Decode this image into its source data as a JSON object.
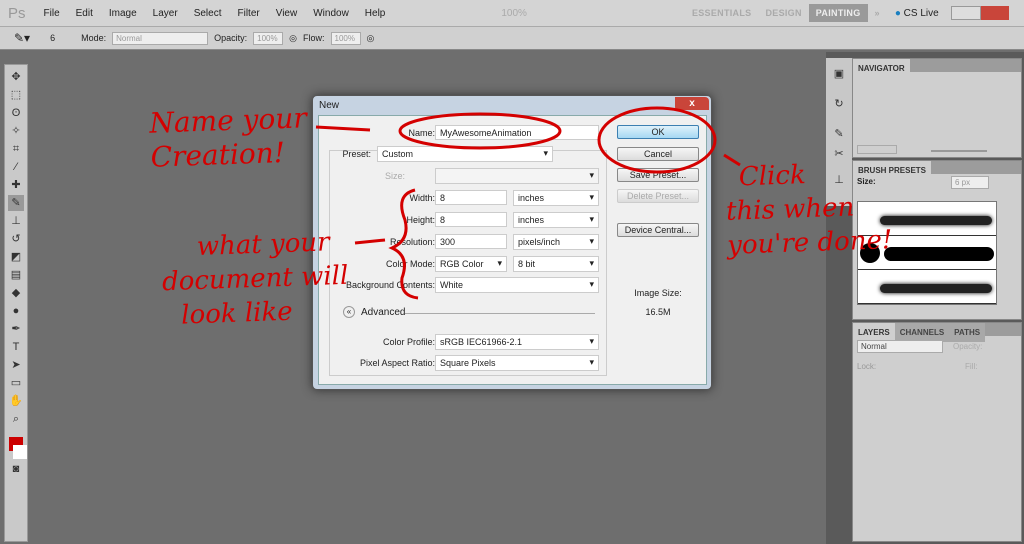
{
  "menubar": {
    "logo": "Ps",
    "items": [
      "File",
      "Edit",
      "Image",
      "Layer",
      "Select",
      "Filter",
      "View",
      "Window",
      "Help"
    ],
    "zoom": "100%",
    "workspaces": [
      "ESSENTIALS",
      "DESIGN",
      "PAINTING"
    ],
    "active_workspace": "PAINTING",
    "more": "»",
    "cslive": "CS Live"
  },
  "options": {
    "brush_size": "6",
    "mode_label": "Mode:",
    "mode": "Normal",
    "opacity_label": "Opacity:",
    "opacity": "100%",
    "flow_label": "Flow:",
    "flow": "100%"
  },
  "panels": {
    "navigator": "NAVIGATOR",
    "brush_presets": "BRUSH PRESETS",
    "size_label": "Size:",
    "size_value": "6 px",
    "layers_tabs": [
      "LAYERS",
      "CHANNELS",
      "PATHS"
    ],
    "blend": "Normal",
    "opacity_label": "Opacity:",
    "lock_label": "Lock:",
    "fill_label": "Fill:"
  },
  "dialog": {
    "title": "New",
    "close": "x",
    "name_label": "Name:",
    "name": "MyAwesomeAnimation",
    "preset_label": "Preset:",
    "preset": "Custom",
    "size_label": "Size:",
    "width_label": "Width:",
    "width": "8",
    "width_unit": "inches",
    "height_label": "Height:",
    "height": "8",
    "height_unit": "inches",
    "res_label": "Resolution:",
    "res": "300",
    "res_unit": "pixels/inch",
    "mode_label": "Color Mode:",
    "mode": "RGB Color",
    "depth": "8 bit",
    "bg_label": "Background Contents:",
    "bg": "White",
    "advanced": "Advanced",
    "profile_label": "Color Profile:",
    "profile": "sRGB IEC61966-2.1",
    "par_label": "Pixel Aspect Ratio:",
    "par": "Square Pixels",
    "ok": "OK",
    "cancel": "Cancel",
    "save_preset": "Save Preset...",
    "delete_preset": "Delete Preset...",
    "device_central": "Device Central...",
    "image_size_label": "Image Size:",
    "image_size": "16.5M"
  },
  "annotations": {
    "name": [
      "Name your",
      "Creation!"
    ],
    "look": [
      "what your",
      "document will",
      "look like"
    ],
    "click": [
      "Click",
      "this when",
      "you're done!"
    ]
  },
  "colors": {
    "annotation": "#d40000",
    "foreground": "#cc0000"
  }
}
